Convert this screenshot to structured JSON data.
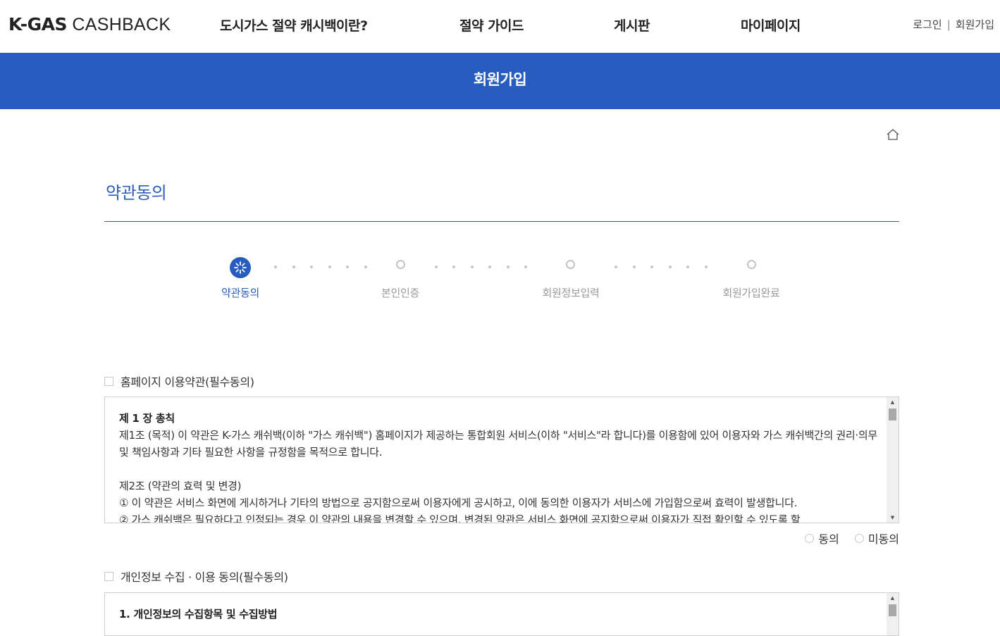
{
  "header": {
    "logo_bold": "K-GAS",
    "logo_light": "CASHBACK",
    "nav": [
      "도시가스 절약 캐시백이란?",
      "절약 가이드",
      "게시판",
      "마이페이지"
    ],
    "login_label": "로그인",
    "separator": "|",
    "signup_label": "회원가입"
  },
  "banner": {
    "title": "회원가입"
  },
  "breadcrumb": {
    "home_icon": "home-icon"
  },
  "section": {
    "title": "약관동의"
  },
  "steps": [
    {
      "label": "약관동의",
      "state": "active"
    },
    {
      "label": "본인인증",
      "state": "pending"
    },
    {
      "label": "회원정보입력",
      "state": "pending"
    },
    {
      "label": "회원가입완료",
      "state": "pending"
    }
  ],
  "agreements": [
    {
      "title": "홈페이지 이용약관(필수동의)",
      "paragraphs": [
        "제 1 장 총칙",
        "제1조 (목적) 이 약관은 K-가스 캐쉬백(이하 \"가스 캐쉬백\") 홈페이지가 제공하는 통합회원 서비스(이하 \"서비스\"라 합니다)를 이용함에 있어 이용자와 가스 캐쉬백간의 권리·의무 및 책임사항과 기타 필요한 사항을 규정함을 목적으로 합니다.",
        "",
        "제2조 (약관의 효력 및 변경)",
        "① 이 약관은 서비스 화면에 게시하거나 기타의 방법으로 공지함으로써 이용자에게 공시하고, 이에 동의한 이용자가 서비스에 가입함으로써 효력이 발생합니다.",
        "② 가스 캐쉬백은 필요하다고 인정되는 경우 이 약관의 내용을 변경할 수 있으며, 변경된 약관은 서비스 화면에 공지함으로써 이용자가 직접 확인할 수 있도록 할"
      ],
      "agree_label": "동의",
      "disagree_label": "미동의"
    },
    {
      "title": "개인정보 수집 · 이용 동의(필수동의)",
      "paragraphs": [
        "1. 개인정보의 수집항목 및 수집방법"
      ]
    }
  ],
  "colors": {
    "brand_blue": "#285dbf",
    "title_blue": "#2d5fb8",
    "inactive_gray": "#c4c4c4"
  }
}
